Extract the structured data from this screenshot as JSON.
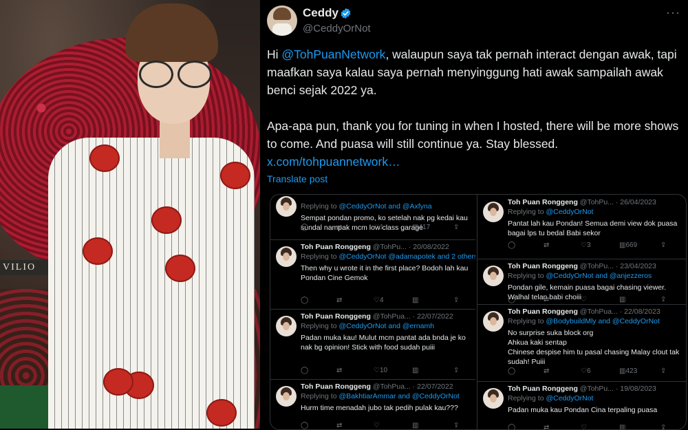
{
  "photo": {
    "sign_text": "VILIO"
  },
  "tweet": {
    "name": "Ceddy",
    "handle": "@CeddyOrNot",
    "more": "···",
    "p1_pre": "Hi ",
    "p1_mention": "@TohPuanNetwork",
    "p1_post": ", walaupun saya tak pernah interact dengan awak, tapi maafkan saya kalau saya pernah menyinggung hati awak sampailah awak benci sejak 2022 ya.",
    "p2": "Apa-apa pun, thank you for tuning in when I hosted, there will be more shows to come. And puasa will still continue ya. Stay blessed.",
    "link": "x.com/tohpuannetwork…",
    "translate": "Translate post"
  },
  "collage": {
    "left": [
      {
        "name": "",
        "meta": "",
        "reply_pre": "Replying to ",
        "reply_bold": "@CeddyOrNot and @Axfyna",
        "text": "Sempat pondan promo, ko setelah nak pg kedai kau sundal nampak mcm low class garage",
        "stats": [
          "",
          "",
          "1",
          "417"
        ]
      },
      {
        "name": "Toh Puan Ronggeng",
        "meta": " @TohPu... · 20/08/2022",
        "reply_pre": "Replying to ",
        "reply_bold": "@CeddyOrNot @adamapotek and 2 others",
        "text": "Then why u wrote it in the first place? Bodoh lah kau Pondan Cine Gemok",
        "stats": [
          "",
          "",
          "4",
          ""
        ]
      },
      {
        "name": "Toh Puan Ronggeng",
        "meta": " @TohPua... · 22/07/2022",
        "reply_pre": "Replying to ",
        "reply_bold": "@CeddyOrNot and @ernamh",
        "text": "Padan muka kau! Mulut mcm pantat ada bnda je ko nak bg opinion! Stick with food sudah puiii",
        "stats": [
          "",
          "",
          "10",
          ""
        ]
      },
      {
        "name": "Toh Puan Ronggeng",
        "meta": " @TohPua... · 22/07/2022",
        "reply_pre": "Replying to ",
        "reply_bold": "@BakhtiarAmmar and @CeddyOrNot",
        "text": "Hurm time menadah jubo tak pedih pulak kau???",
        "stats": [
          "",
          "",
          "",
          ""
        ]
      }
    ],
    "right": [
      {
        "name": "Toh Puan Ronggeng",
        "meta": " @TohPu... · 26/04/2023",
        "reply_pre": "Replying to ",
        "reply_bold": "@CeddyOrNot",
        "text": "Pantat lah kau Pondan! Semua demi view dok puasa bagai lps tu bedal Babi sekor",
        "stats": [
          "",
          "",
          "3",
          "669"
        ]
      },
      {
        "name": "Toh Puan Ronggeng",
        "meta": " @TohPu... · 23/04/2023",
        "reply_pre": "Replying to ",
        "reply_bold": "@CeddyOrNot and @anjezzeros",
        "text": "Pondan gile, kemain puasa bagai chasing viewer. Walhal telan babi choiii",
        "stats": [
          "",
          "",
          "",
          ""
        ]
      },
      {
        "name": "Toh Puan Ronggeng",
        "meta": " @TohPua... · 22/08/2023",
        "reply_pre": "Replying to ",
        "reply_bold": "@BodybuildMly and @CeddyOrNot",
        "text": "No surprise suka block org\nAhkua kaki sentap\nChinese despise him tu pasal chasing Malay clout tak sudah! Puiii",
        "stats": [
          "",
          "",
          "6",
          "423"
        ]
      },
      {
        "name": "Toh Puan Ronggeng",
        "meta": " @TohPu... · 19/08/2023",
        "reply_pre": "Replying to ",
        "reply_bold": "@CeddyOrNot",
        "text": "Padan muka kau Pondan Cina terpaling puasa",
        "stats": [
          "",
          "",
          "",
          ""
        ]
      }
    ]
  }
}
